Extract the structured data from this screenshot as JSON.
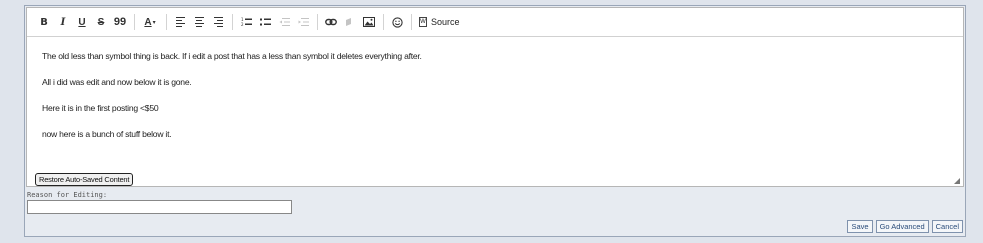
{
  "toolbar": {
    "bold": "B",
    "italic": "I",
    "underline": "U",
    "strike": "S",
    "quote": "99",
    "text_color": "A",
    "source_label": "Source",
    "source_doc": "W"
  },
  "content": {
    "paragraphs": [
      "The old less than symbol thing is back. If i edit a post that has a less than symbol it deletes everything after.",
      "All i did was edit and now below it is gone.",
      "Here it is in the first posting <$50",
      "now here is a bunch of stuff below it."
    ]
  },
  "restore_label": "Restore Auto-Saved Content",
  "reason": {
    "label": "Reason for Editing:",
    "value": ""
  },
  "buttons": {
    "save": "Save",
    "go_advanced": "Go Advanced",
    "cancel": "Cancel"
  },
  "colors": {
    "page_bg": "#dfe4ec",
    "button_text": "#2a4c7a"
  },
  "icons": [
    "bold-icon",
    "italic-icon",
    "underline-icon",
    "strikethrough-icon",
    "quote-icon",
    "text-color-icon",
    "align-left-icon",
    "align-center-icon",
    "align-right-icon",
    "ordered-list-icon",
    "unordered-list-icon",
    "outdent-icon",
    "indent-icon",
    "link-icon",
    "unlink-icon",
    "image-icon",
    "smiley-icon",
    "source-icon"
  ]
}
